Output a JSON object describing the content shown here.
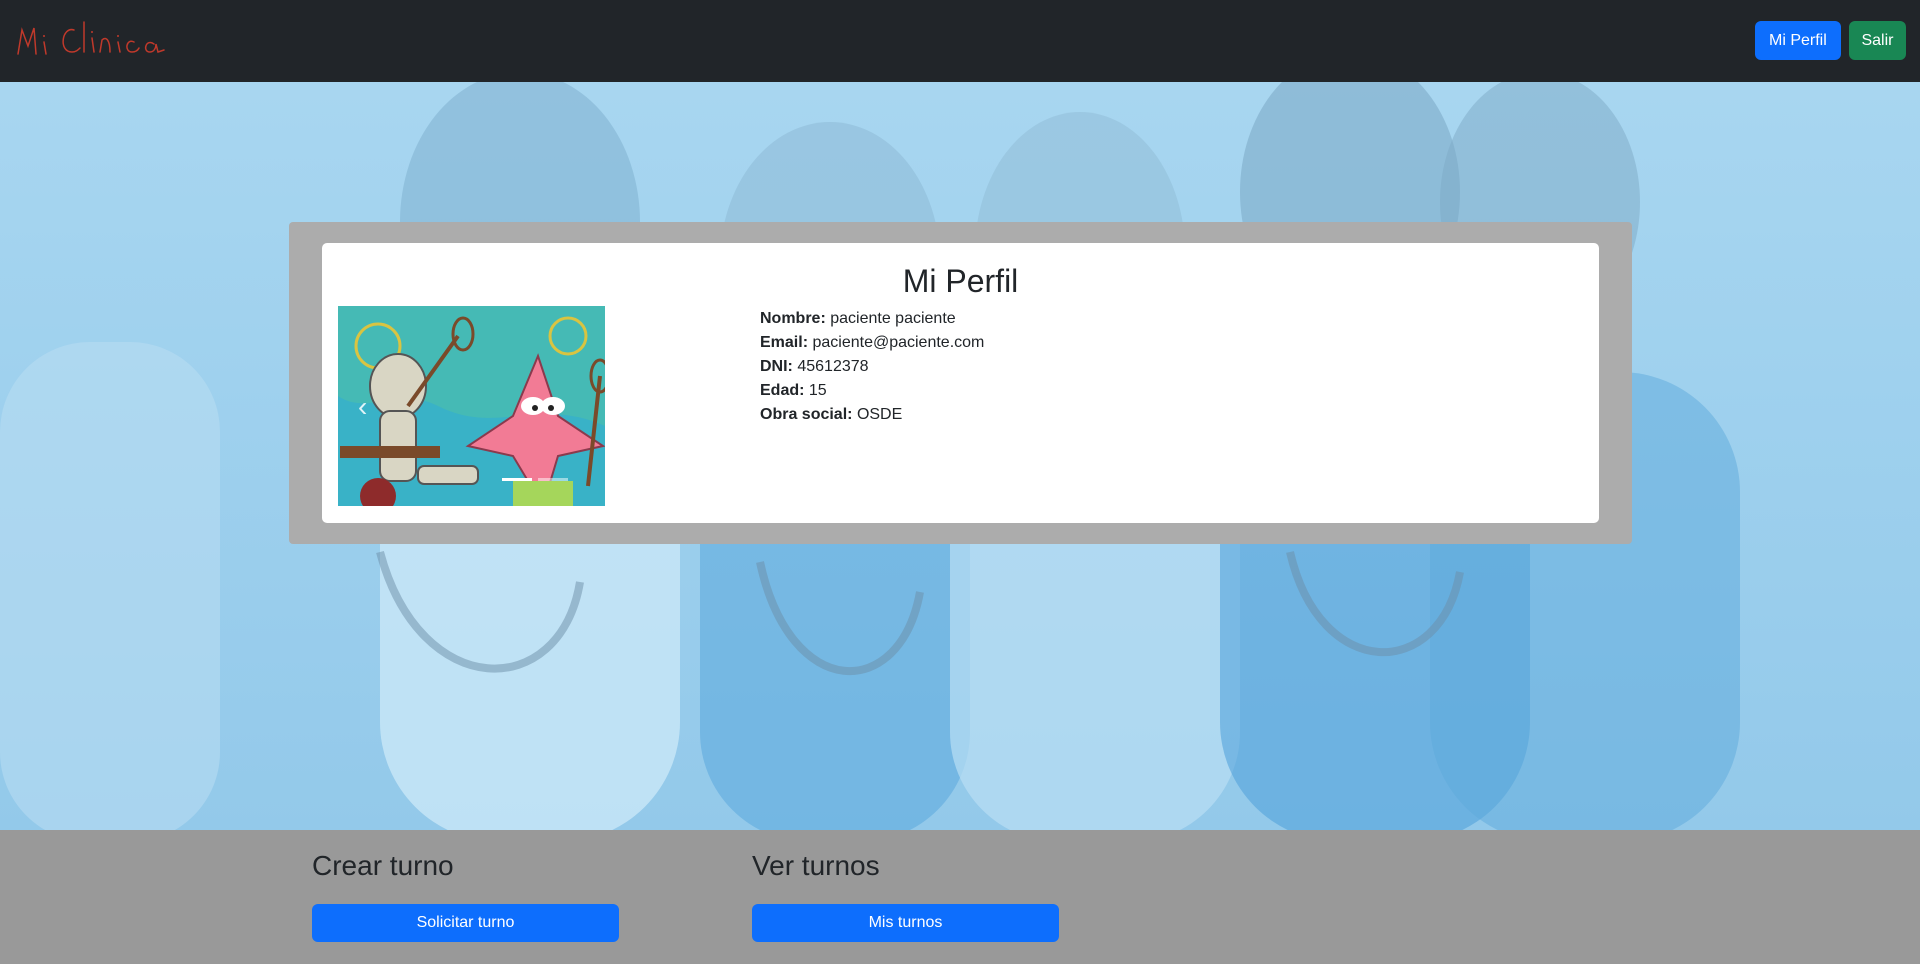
{
  "navbar": {
    "brand": "Mi Clinica",
    "profile_label": "Mi Perfil",
    "exit_label": "Salir"
  },
  "profile": {
    "title": "Mi Perfil",
    "fields": [
      {
        "label": "Nombre:",
        "value": "paciente paciente"
      },
      {
        "label": "Email:",
        "value": "paciente@paciente.com"
      },
      {
        "label": "DNI:",
        "value": "45612378"
      },
      {
        "label": "Edad:",
        "value": "15"
      },
      {
        "label": "Obra social:",
        "value": "OSDE"
      }
    ],
    "carousel_prev_glyph": "‹"
  },
  "actions": {
    "create": {
      "heading": "Crear turno",
      "button": "Solicitar turno"
    },
    "view": {
      "heading": "Ver turnos",
      "button": "Mis turnos"
    }
  },
  "colors": {
    "navbar": "#212529",
    "primary": "#0d6efd",
    "success": "#198754",
    "hero": "#9fd1ee",
    "bottom": "#999999"
  }
}
